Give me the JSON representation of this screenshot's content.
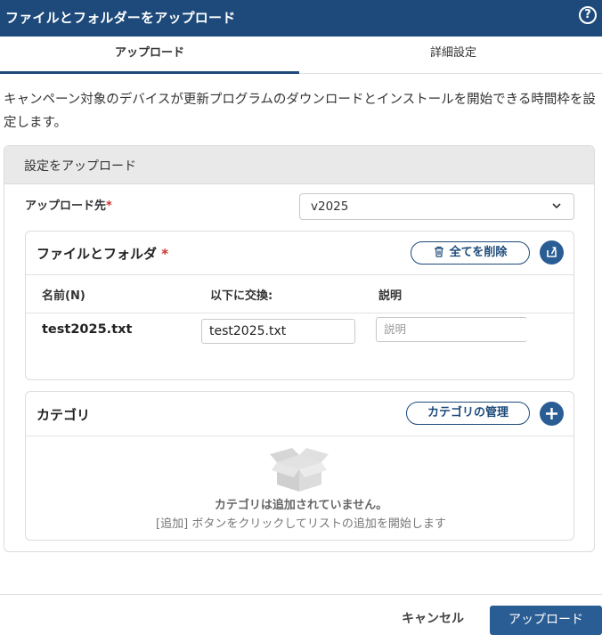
{
  "window": {
    "title": "ファイルとフォルダーをアップロード",
    "help_icon": "help-circle-icon"
  },
  "tabs": [
    {
      "label": "アップロード",
      "active": true
    },
    {
      "label": "詳細設定",
      "active": false
    }
  ],
  "description": "キャンペーン対象のデバイスが更新プログラムのダウンロードとインストールを開始できる時間枠を設定します。",
  "section": {
    "title": "設定をアップロード",
    "destination": {
      "label": "アップロード先",
      "required_mark": "*",
      "value": "v2025"
    }
  },
  "files": {
    "title": "ファイルとフォルダ",
    "required_mark": "*",
    "delete_all_label": "全てを削除",
    "columns": [
      "名前(N)",
      "以下に交換:",
      "説明"
    ],
    "rows": [
      {
        "name": "test2025.txt",
        "replace_with": "test2025.txt",
        "description_placeholder": "説明"
      }
    ]
  },
  "categories": {
    "title": "カテゴリ",
    "manage_label": "カテゴリの管理",
    "empty_title": "カテゴリは追加されていません。",
    "empty_hint": "[追加] ボタンをクリックしてリストの追加を開始します"
  },
  "footer": {
    "cancel_label": "キャンセル",
    "upload_label": "アップロード"
  },
  "colors": {
    "primary": "#1d4a7a",
    "button": "#2a5d93",
    "required": "#d0312d",
    "panel_header": "#e9e9e9"
  }
}
